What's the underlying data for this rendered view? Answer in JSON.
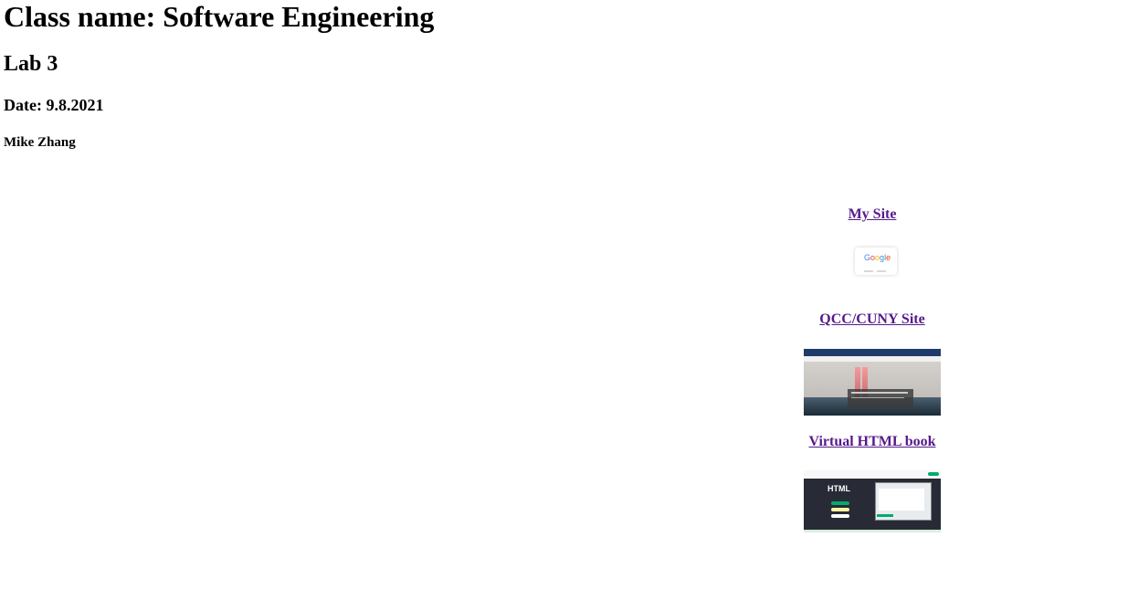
{
  "header": {
    "class_name": "Class name: Software Engineering",
    "lab": "Lab 3",
    "date": "Date: 9.8.2021",
    "author": "Mike Zhang"
  },
  "links": [
    {
      "label": "My Site",
      "thumbnail": "google-homepage-screenshot"
    },
    {
      "label": "QCC/CUNY Site",
      "thumbnail": "qcc-homepage-screenshot"
    },
    {
      "label": "Virtual HTML book",
      "thumbnail": "w3schools-html-screenshot"
    }
  ],
  "thumbnail_text": {
    "google_logo": "Google",
    "html_title": "HTML"
  },
  "colors": {
    "visited_link": "#551a8b",
    "qcc_nav": "#1f3b6b",
    "w3_dark": "#282a35",
    "w3_green": "#04aa6d"
  }
}
